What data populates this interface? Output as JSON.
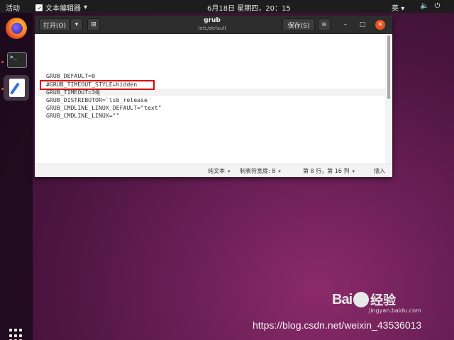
{
  "topbar": {
    "activities": "活动",
    "app_menu": "文本编辑器",
    "clock": "6月18日 星期四，20：15",
    "input_method": "英",
    "tray_icons": [
      "volume-icon",
      "power-icon"
    ]
  },
  "dock": {
    "items": [
      "firefox",
      "terminal",
      "text-editor"
    ],
    "terminal_prompt": ">_"
  },
  "window": {
    "title": "grub",
    "subtitle": "/etc/default",
    "open_label": "打开(O)",
    "save_label": "保存(S)"
  },
  "editor": {
    "lines": [
      "GRUB_DEFAULT=0",
      "#GRUB_TIMEOUT_STYLE=hidden",
      "GRUB_TIMEOUT=30",
      "GRUB_DISTRIBUTOR=`lsb_release",
      "GRUB_CMDLINE_LINUX_DEFAULT=\"text\"",
      "GRUB_CMDLINE_LINUX=\"\""
    ],
    "highlighted_line": 1,
    "current_line": 2
  },
  "statusbar": {
    "language": "纯文本",
    "tab_width": "制表符宽度: 8",
    "position": "第 8 行，第 16 列",
    "mode": "插入"
  },
  "watermark": {
    "baidu": "Bai",
    "baidu_cn": "经验",
    "jingyan": "jingyan.baidu.com",
    "csdn": "https://blog.csdn.net/weixin_43536013"
  },
  "colors": {
    "accent": "#e95420",
    "highlight_box": "#e00000",
    "headerbar": "#2d2d2d"
  }
}
